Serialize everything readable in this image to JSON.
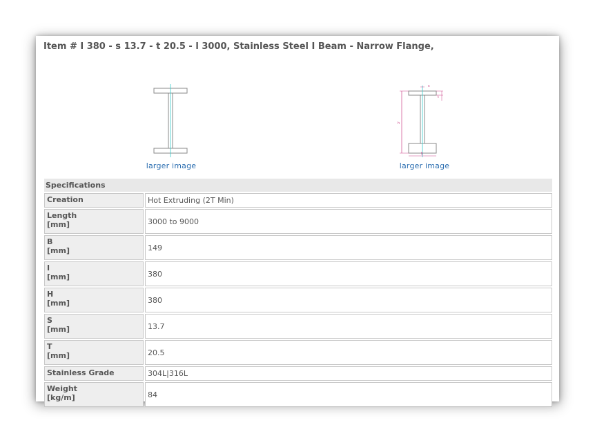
{
  "title": "Item # I 380 - s 13.7 - t 20.5 - l 3000, Stainless Steel I Beam - Narrow Flange,",
  "images": [
    {
      "link": "larger image"
    },
    {
      "link": "larger image",
      "dimension_labels": {
        "s": "s",
        "t": "t",
        "h": "h",
        "b": "b"
      }
    }
  ],
  "specs": {
    "header": "Specifications",
    "rows": [
      {
        "label": "Creation",
        "unit": "",
        "value": "Hot Extruding (2T Min)"
      },
      {
        "label": "Length",
        "unit": "[mm]",
        "value": "3000 to 9000"
      },
      {
        "label": "B",
        "unit": "[mm]",
        "value": "149"
      },
      {
        "label": "I",
        "unit": "[mm]",
        "value": "380"
      },
      {
        "label": "H",
        "unit": "[mm]",
        "value": "380"
      },
      {
        "label": "S",
        "unit": "[mm]",
        "value": "13.7"
      },
      {
        "label": "T",
        "unit": "[mm]",
        "value": "20.5"
      },
      {
        "label": "Stainless Grade",
        "unit": "",
        "value": "304L|316L"
      },
      {
        "label": "Weight",
        "unit": "[kg/m]",
        "value": "84"
      }
    ]
  },
  "colors": {
    "link": "#2a6db0",
    "label_bg": "#eeeeee",
    "border": "#c8c8c8",
    "header_bg": "#e8e8e8",
    "drawing_line": "#888888",
    "center_line": "#33cccc",
    "dimension_line": "#cc4488"
  }
}
